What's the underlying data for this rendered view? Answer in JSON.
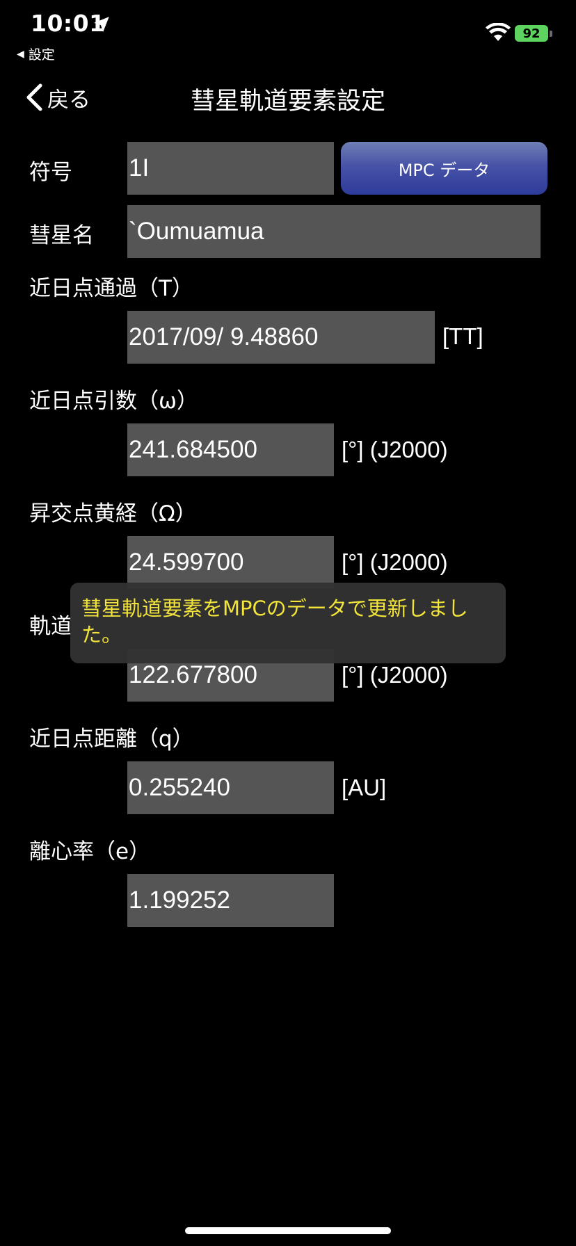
{
  "status_bar": {
    "time": "10:01",
    "back_app": "設定",
    "battery": "92"
  },
  "nav": {
    "back_label": "戻る",
    "title": "彗星軌道要素設定"
  },
  "form": {
    "symbol_label": "符号",
    "symbol_value": "1I",
    "mpc_button": "MPC データ",
    "name_label": "彗星名",
    "name_value": "`Oumuamua",
    "perihelion_time_label": "近日点通過（T）",
    "perihelion_time_value": "2017/09/ 9.48860",
    "perihelion_time_unit": "[TT]",
    "arg_perihelion_label": "近日点引数（ω）",
    "arg_perihelion_value": "241.684500",
    "arg_perihelion_unit": "[°] (J2000)",
    "asc_node_label": "昇交点黄経（Ω）",
    "asc_node_value": "24.599700",
    "asc_node_unit": "[°] (J2000)",
    "inclination_label_visible": "軌道",
    "inclination_value": "122.677800",
    "inclination_unit": "[°] (J2000)",
    "perihelion_dist_label": "近日点距離（q）",
    "perihelion_dist_value": "0.255240",
    "perihelion_dist_unit": "[AU]",
    "eccentricity_label": "離心率（e）",
    "eccentricity_value": "1.199252"
  },
  "toast": {
    "message": "彗星軌道要素をMPCのデータで更新しました。"
  },
  "colors": {
    "background": "#000000",
    "field_bg": "#555555",
    "button_top": "#6f7fb6",
    "button_bottom": "#2e3b9a",
    "toast_text": "#f2e43a",
    "battery": "#5ed35f"
  }
}
